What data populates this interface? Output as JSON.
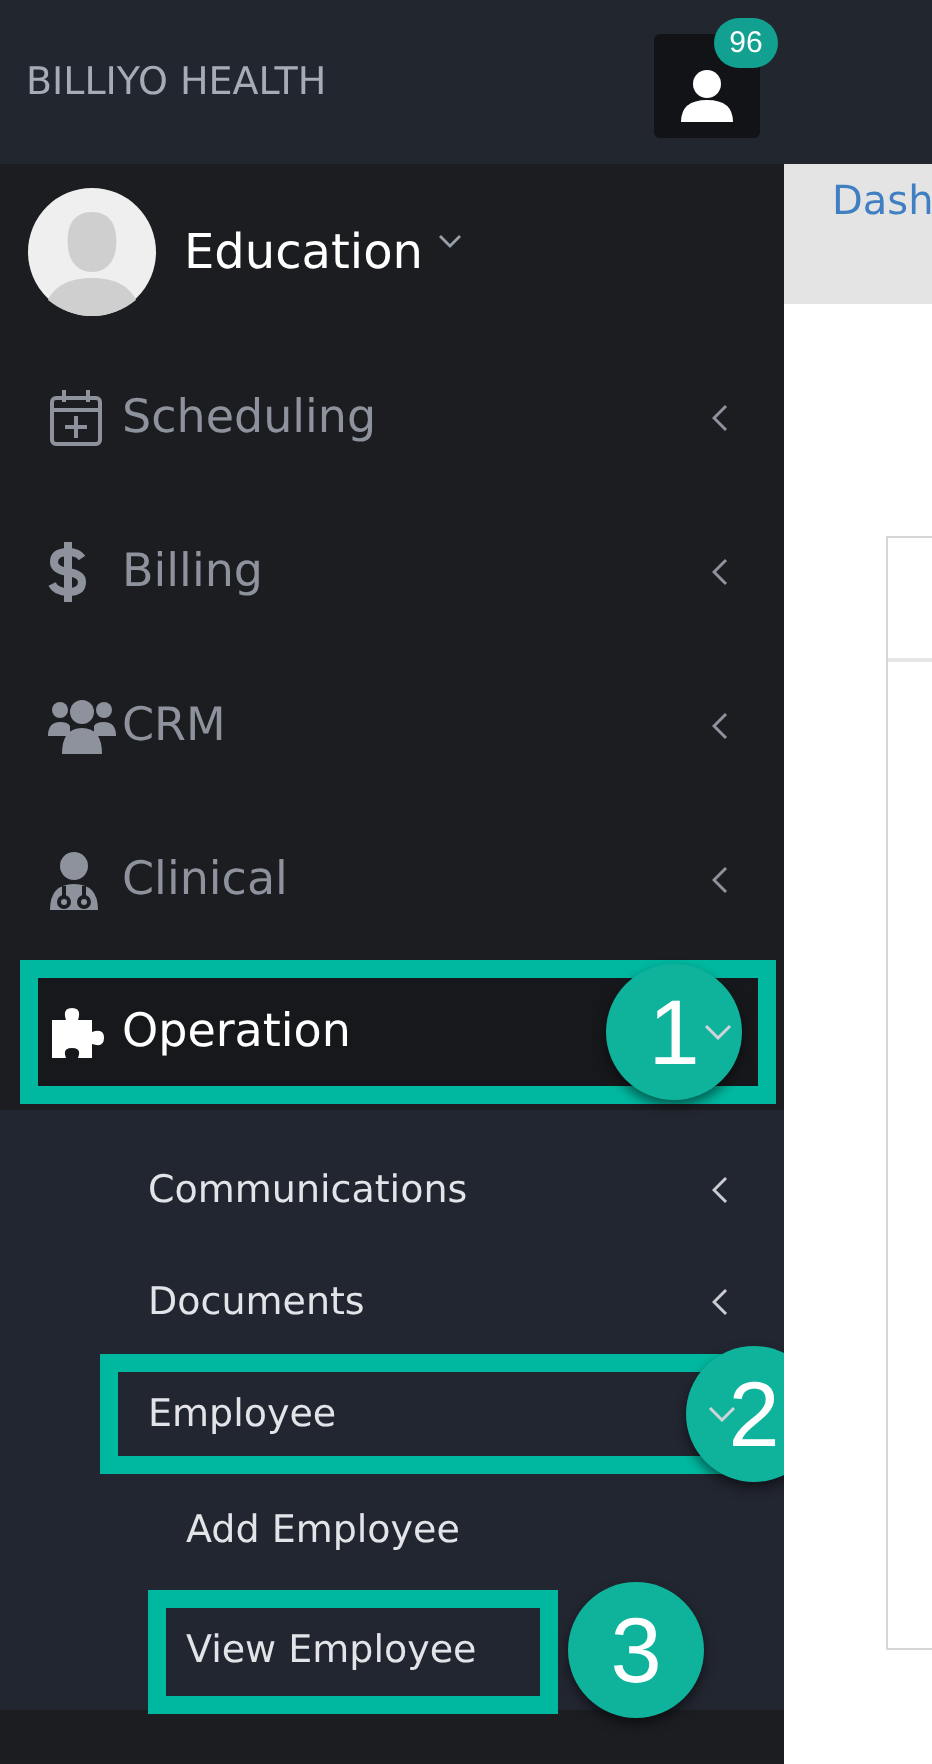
{
  "header": {
    "brand": "BILLIYO HEALTH",
    "notification_count": "96"
  },
  "profile": {
    "name": "Education"
  },
  "menu": [
    {
      "label": "Scheduling",
      "expanded": false
    },
    {
      "label": "Billing",
      "expanded": false
    },
    {
      "label": "CRM",
      "expanded": false
    },
    {
      "label": "Clinical",
      "expanded": false
    },
    {
      "label": "Operation",
      "expanded": true,
      "callout": "1",
      "children": [
        {
          "label": "Communications",
          "expanded": false
        },
        {
          "label": "Documents",
          "expanded": false
        },
        {
          "label": "Employee",
          "expanded": true,
          "callout": "2",
          "children": [
            {
              "label": "Add Employee"
            },
            {
              "label": "View Employee",
              "callout": "3"
            }
          ]
        }
      ]
    }
  ],
  "content": {
    "breadcrumb": "Dash"
  }
}
